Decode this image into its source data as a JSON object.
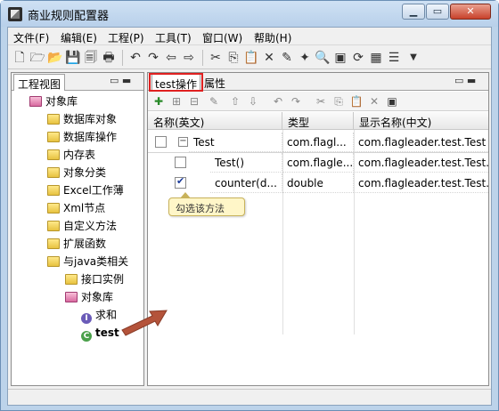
{
  "window": {
    "title": "商业规则配置器",
    "min_label": "▁",
    "max_label": "▭",
    "close_label": "✕"
  },
  "menu": [
    "文件(F)",
    "编辑(E)",
    "工程(P)",
    "工具(T)",
    "窗口(W)",
    "帮助(H)"
  ],
  "left_pane": {
    "tab_label": "工程视图",
    "controls": "▭ ▬",
    "tree": [
      {
        "label": "对象库",
        "icon": "database-icon",
        "level": 0
      },
      {
        "label": "数据库对象",
        "icon": "folder-icon",
        "level": 1
      },
      {
        "label": "数据库操作",
        "icon": "folder-icon",
        "level": 1
      },
      {
        "label": "内存表",
        "icon": "folder-icon",
        "level": 1
      },
      {
        "label": "对象分类",
        "icon": "folder-icon",
        "level": 1
      },
      {
        "label": "Excel工作薄",
        "icon": "folder-icon",
        "level": 1
      },
      {
        "label": "Xml节点",
        "icon": "folder-icon",
        "level": 1
      },
      {
        "label": "自定义方法",
        "icon": "folder-icon",
        "level": 1
      },
      {
        "label": "扩展函数",
        "icon": "folder-icon",
        "level": 1
      },
      {
        "label": "与java类相关",
        "icon": "folder-icon",
        "level": 1
      },
      {
        "label": "接口实例",
        "icon": "folder-icon",
        "level": 2
      },
      {
        "label": "对象库",
        "icon": "database-icon",
        "level": 2
      },
      {
        "label": "求和",
        "icon": "interface-icon",
        "level": 3
      },
      {
        "label": "test",
        "icon": "class-icon",
        "level": 3
      }
    ]
  },
  "right_pane": {
    "tabs": {
      "active": "test操作",
      "props": "属性"
    },
    "controls": "▭ ▬",
    "columns": [
      "名称(英文)",
      "类型",
      "显示名称(中文)"
    ],
    "rows": [
      {
        "name": "Test",
        "type": "com.flagl...",
        "display": "com.flagleader.test.Test",
        "checked": false
      },
      {
        "name": "Test()",
        "type": "com.flagle...",
        "display": "com.flagleader.test.Test.T",
        "checked": false
      },
      {
        "name": "counter(d...",
        "type": "double",
        "display": "com.flagleader.test.Test.c",
        "checked": true
      }
    ],
    "tooltip": "勾选该方法",
    "scroll_thumb": "|||"
  }
}
